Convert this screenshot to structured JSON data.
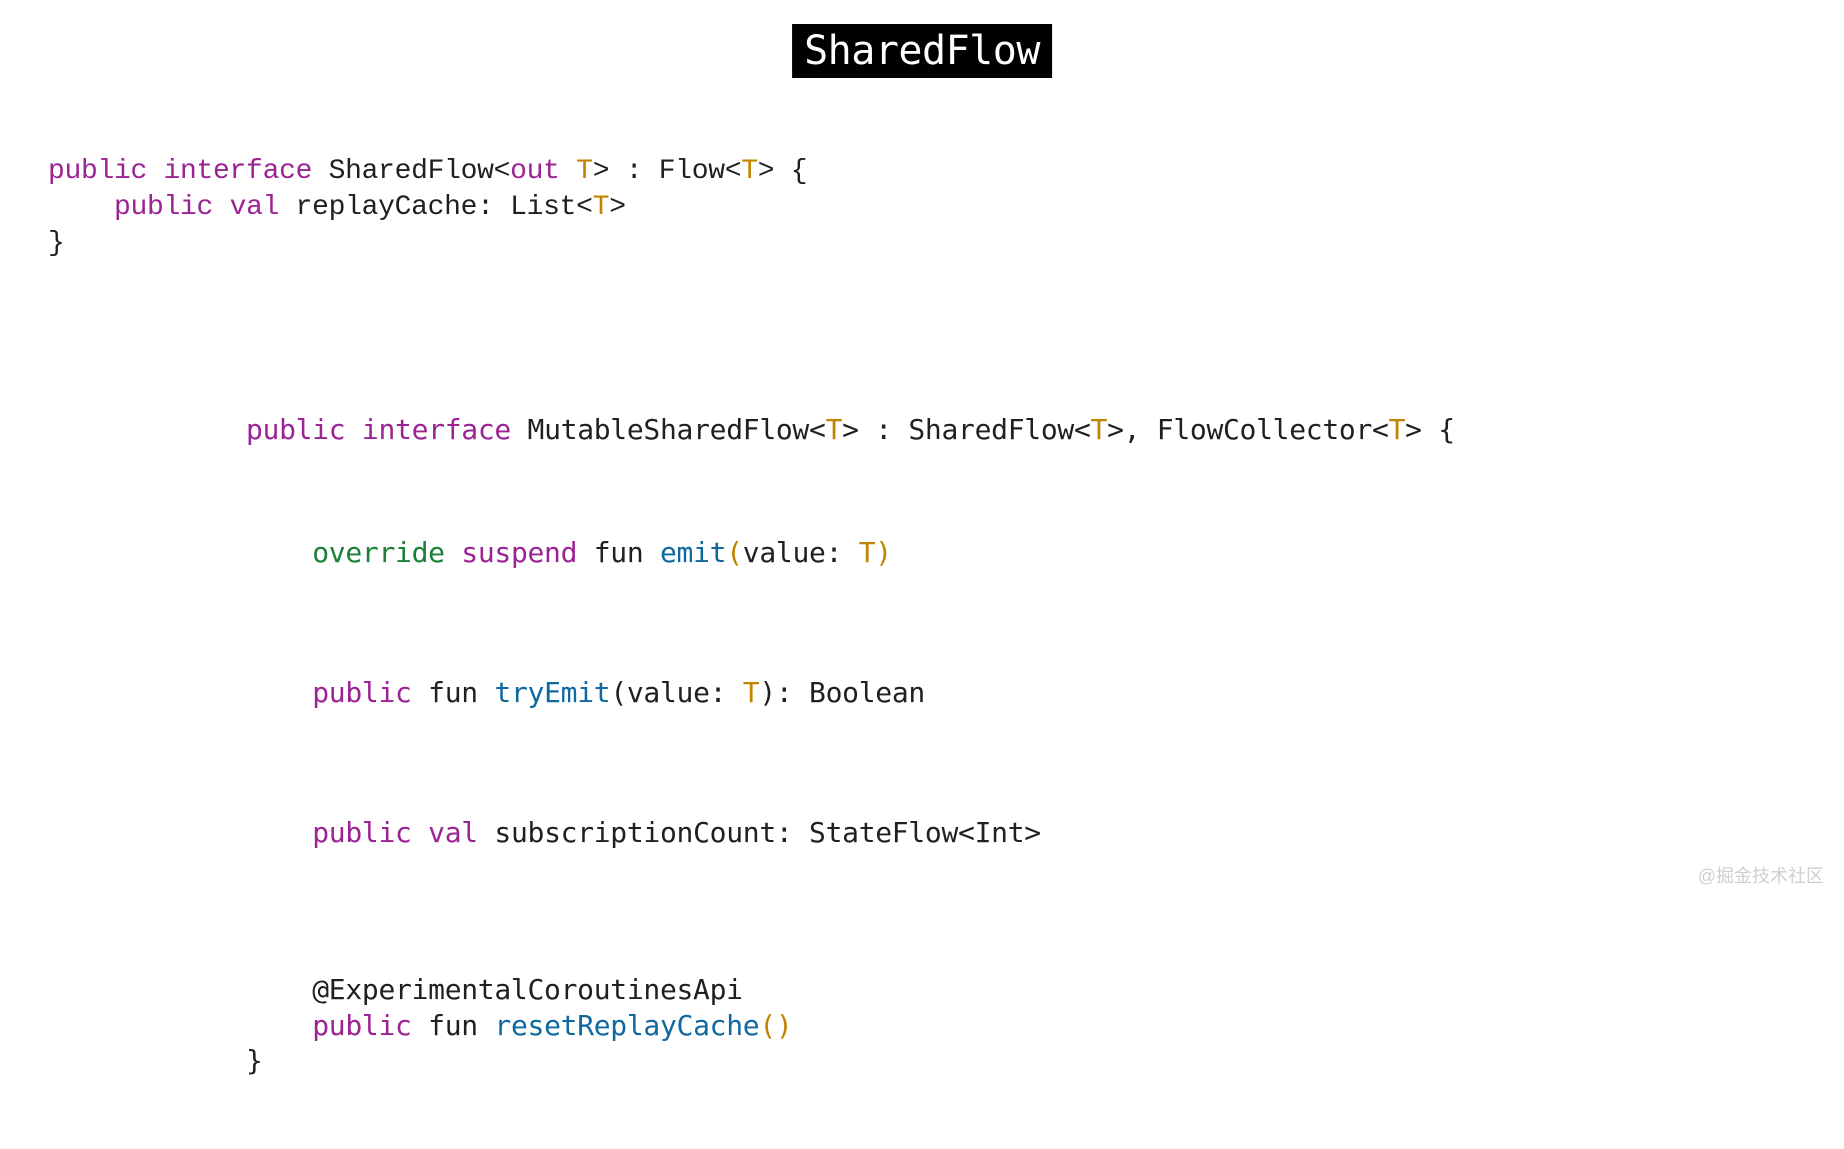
{
  "title": "SharedFlow",
  "watermark": "@掘金技术社区",
  "colors": {
    "keyword": "#9b2393",
    "modifier": "#1a7f37",
    "typeParam": "#c18401",
    "text": "#1f1f24",
    "identifier": "#0f68a0",
    "titleBg": "#000000",
    "titleFg": "#ffffff",
    "bg": "#ffffff"
  },
  "block1": {
    "l1": {
      "public": "public",
      "interface": "interface",
      "name": "SharedFlow",
      "lt": "<",
      "out": "out",
      "T": "T",
      "gt": ">",
      "colon": " : ",
      "Flow": "Flow",
      "lt2": "<",
      "T2": "T",
      "gt2": ">",
      "brace": " {"
    },
    "l2": {
      "indent": "    ",
      "public": "public",
      "val": "val",
      "prop": "replayCache",
      "colon": ": ",
      "List": "List",
      "lt": "<",
      "T": "T",
      "gt": ">"
    },
    "l3": {
      "brace": "}"
    }
  },
  "block2": {
    "l1": {
      "public": "public",
      "interface": "interface",
      "name": "MutableSharedFlow",
      "lt": "<",
      "T": "T",
      "gt": ">",
      "colon": " : ",
      "Shared": "SharedFlow",
      "lt2": "<",
      "T2": "T",
      "gt2": ">",
      "comma": ", ",
      "FC": "FlowCollector",
      "lt3": "<",
      "T3": "T",
      "gt3": ">",
      "brace": " {"
    },
    "l2": {
      "indent": "    ",
      "override": "override",
      "suspend": "suspend",
      "fun": "fun",
      "name": "emit",
      "lp": "(",
      "arg": "value",
      "colon": ": ",
      "T": "T",
      "rp": ")"
    },
    "l3": {
      "indent": "    ",
      "public": "public",
      "fun": "fun",
      "name": "tryEmit",
      "lp": "(",
      "arg": "value",
      "colon": ": ",
      "T": "T",
      "rp": ")",
      "ret": ": ",
      "Bool": "Boolean"
    },
    "l4": {
      "indent": "    ",
      "public": "public",
      "val": "val",
      "prop": "subscriptionCount",
      "colon": ": ",
      "SF": "StateFlow",
      "lt": "<",
      "Int": "Int",
      "gt": ">"
    },
    "l5a": {
      "indent": "    ",
      "anno": "@ExperimentalCoroutinesApi"
    },
    "l5b": {
      "indent": "    ",
      "public": "public",
      "fun": "fun",
      "name": "resetReplayCache",
      "lp": "(",
      "rp": ")"
    },
    "l6": {
      "brace": "}"
    }
  }
}
